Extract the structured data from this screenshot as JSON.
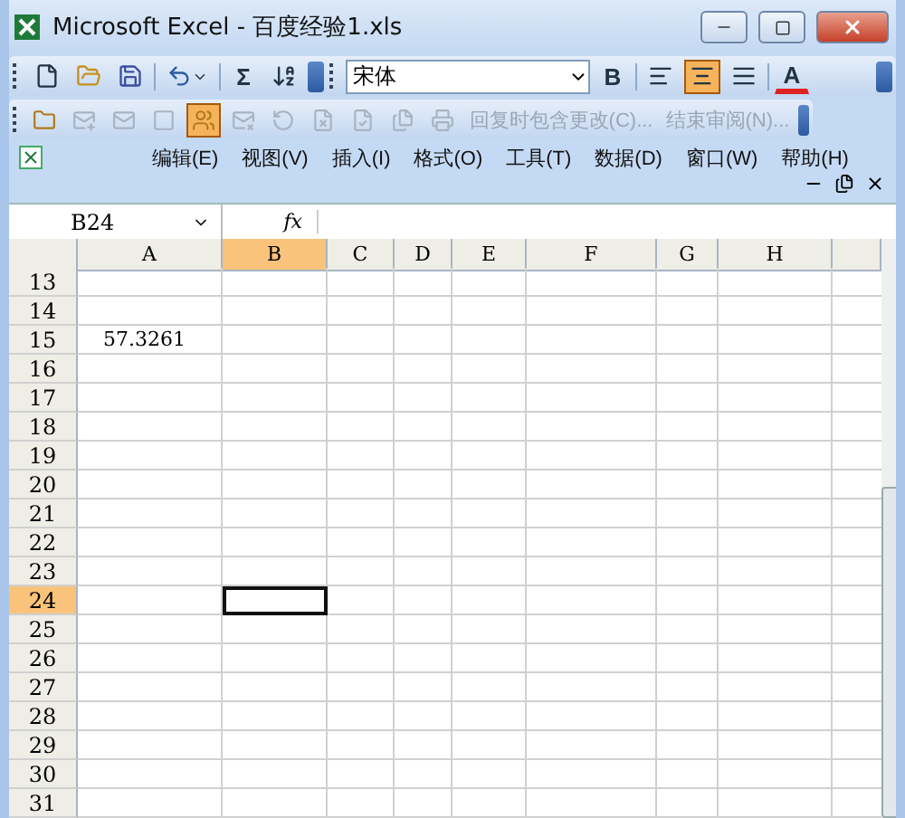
{
  "window": {
    "title": "Microsoft Excel - 百度经验1.xls"
  },
  "toolbar_1": {
    "sum": "Σ",
    "font": "宋体",
    "bold": "B",
    "font_color": "A",
    "align": [
      {
        "selected": false
      },
      {
        "selected": true
      },
      {
        "selected": false
      }
    ]
  },
  "toolbar_2": {
    "buttons": [
      {
        "selected": false,
        "disabled": false
      },
      {
        "selected": false,
        "disabled": true
      },
      {
        "selected": false,
        "disabled": true
      },
      {
        "selected": false,
        "disabled": true
      },
      {
        "selected": true,
        "disabled": false
      },
      {
        "selected": false,
        "disabled": true
      },
      {
        "selected": false,
        "disabled": true
      },
      {
        "selected": false,
        "disabled": true
      },
      {
        "selected": false,
        "disabled": true
      },
      {
        "selected": false,
        "disabled": true
      },
      {
        "selected": false,
        "disabled": true
      }
    ],
    "review": [
      "回复时包含更改(C)...",
      "结束审阅(N)..."
    ]
  },
  "menu": [
    "编辑(E)",
    "视图(V)",
    "插入(I)",
    "格式(O)",
    "工具(T)",
    "数据(D)",
    "窗口(W)",
    "帮助(H)"
  ],
  "formula_bar": {
    "name_box": "B24",
    "fx": "fx"
  },
  "columns": [
    {
      "label": "A",
      "selected": false
    },
    {
      "label": "B",
      "selected": true
    },
    {
      "label": "C",
      "selected": false
    },
    {
      "label": "D",
      "selected": false
    },
    {
      "label": "E",
      "selected": false
    },
    {
      "label": "F",
      "selected": false
    },
    {
      "label": "G",
      "selected": false
    },
    {
      "label": "H",
      "selected": false
    }
  ],
  "rows": [
    {
      "label": "13",
      "selected": false,
      "cells": []
    },
    {
      "label": "14",
      "selected": false,
      "cells": []
    },
    {
      "label": "15",
      "selected": false,
      "cells": [
        "57.3261"
      ]
    },
    {
      "label": "16",
      "selected": false,
      "cells": []
    },
    {
      "label": "17",
      "selected": false,
      "cells": []
    },
    {
      "label": "18",
      "selected": false,
      "cells": []
    },
    {
      "label": "19",
      "selected": false,
      "cells": []
    },
    {
      "label": "20",
      "selected": false,
      "cells": []
    },
    {
      "label": "21",
      "selected": false,
      "cells": []
    },
    {
      "label": "22",
      "selected": false,
      "cells": []
    },
    {
      "label": "23",
      "selected": false,
      "cells": []
    },
    {
      "label": "24",
      "selected": true,
      "cells": []
    },
    {
      "label": "25",
      "selected": false,
      "cells": []
    },
    {
      "label": "26",
      "selected": false,
      "cells": []
    },
    {
      "label": "27",
      "selected": false,
      "cells": []
    },
    {
      "label": "28",
      "selected": false,
      "cells": []
    },
    {
      "label": "29",
      "selected": false,
      "cells": []
    },
    {
      "label": "30",
      "selected": false,
      "cells": []
    },
    {
      "label": "31",
      "selected": false,
      "cells": []
    }
  ]
}
